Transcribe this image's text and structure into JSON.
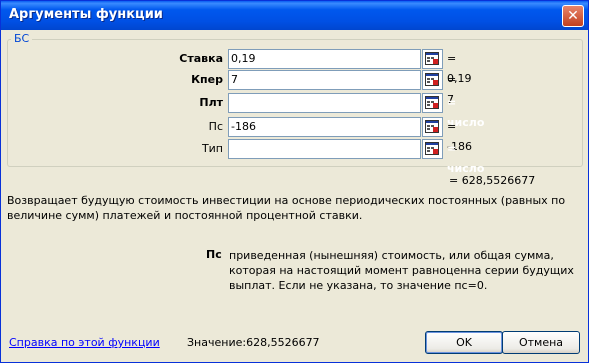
{
  "window": {
    "title": "Аргументы функции",
    "close_glyph": "✕"
  },
  "group": {
    "label": "БС"
  },
  "args": [
    {
      "label": "Ставка",
      "bold": true,
      "value": "0,19",
      "result": "= 0,19",
      "result_is_hint": false
    },
    {
      "label": "Кпер",
      "bold": true,
      "value": "7",
      "result": "= 7",
      "result_is_hint": false
    },
    {
      "label": "Плт",
      "bold": true,
      "value": "",
      "result": "= число",
      "result_is_hint": true
    },
    {
      "label": "Пс",
      "bold": false,
      "value": "-186",
      "result": "= -186",
      "result_is_hint": false
    },
    {
      "label": "Тип",
      "bold": false,
      "value": "",
      "result": "= число",
      "result_is_hint": true
    }
  ],
  "result_total": "= 628,5526677",
  "description": "Возвращает будущую стоимость инвестиции на основе периодических постоянных (равных по величине сумм) платежей и постоянной процентной ставки.",
  "arg_help": {
    "name": "Пс",
    "text": "приведенная (нынешняя) стоимость, или общая сумма, которая на настоящий момент равноценна серии будущих выплат. Если не указана, то значение пс=0."
  },
  "footer": {
    "help_link": "Справка по этой функции",
    "value_label": "Значение:",
    "value": "628,5526677",
    "ok_label": "OK",
    "cancel_label": "Отмена"
  },
  "icons": {
    "range_picker": "range-picker-icon"
  }
}
